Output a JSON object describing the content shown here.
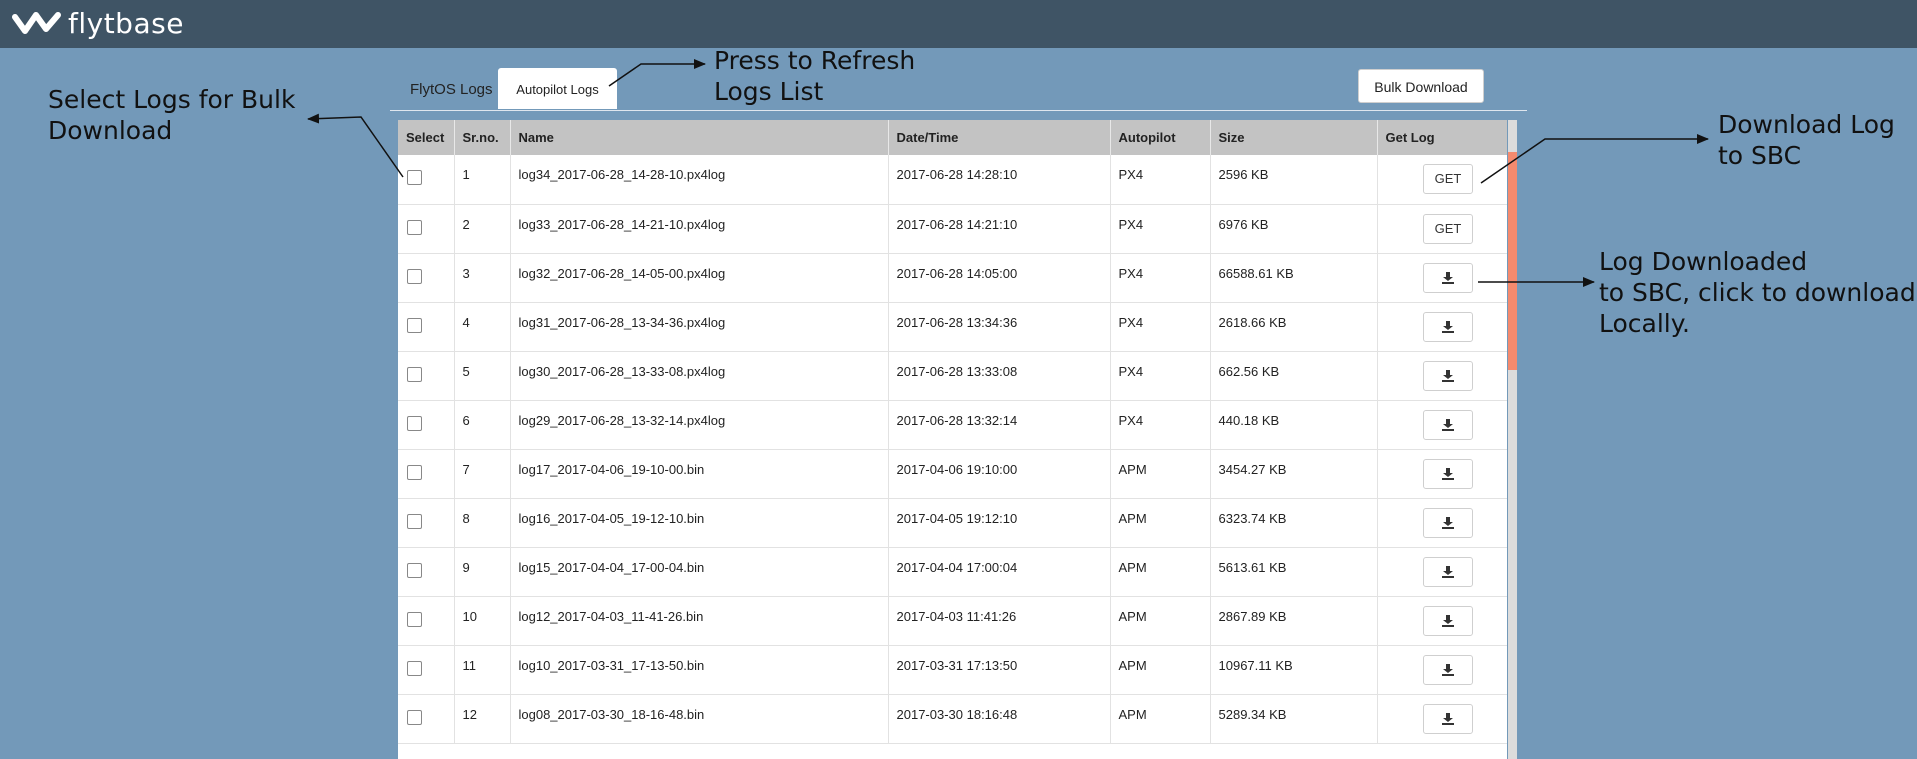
{
  "app": {
    "brand": "flytbase"
  },
  "tabs": [
    {
      "label": "FlytOS Logs",
      "active": false
    },
    {
      "label": "Autopilot Logs",
      "active": true
    }
  ],
  "toolbar": {
    "bulk_download_label": "Bulk Download"
  },
  "table": {
    "headers": [
      "Select",
      "Sr.no.",
      "Name",
      "Date/Time",
      "Autopilot",
      "Size",
      "Get Log"
    ],
    "rows": [
      {
        "sr": "1",
        "name": "log34_2017-06-28_14-28-10.px4log",
        "datetime": "2017-06-28 14:28:10",
        "autopilot": "PX4",
        "size": "2596 KB",
        "action": "get",
        "action_label": "GET"
      },
      {
        "sr": "2",
        "name": "log33_2017-06-28_14-21-10.px4log",
        "datetime": "2017-06-28 14:21:10",
        "autopilot": "PX4",
        "size": "6976 KB",
        "action": "get",
        "action_label": "GET"
      },
      {
        "sr": "3",
        "name": "log32_2017-06-28_14-05-00.px4log",
        "datetime": "2017-06-28 14:05:00",
        "autopilot": "PX4",
        "size": "66588.61 KB",
        "action": "download",
        "action_label": ""
      },
      {
        "sr": "4",
        "name": "log31_2017-06-28_13-34-36.px4log",
        "datetime": "2017-06-28 13:34:36",
        "autopilot": "PX4",
        "size": "2618.66 KB",
        "action": "download",
        "action_label": ""
      },
      {
        "sr": "5",
        "name": "log30_2017-06-28_13-33-08.px4log",
        "datetime": "2017-06-28 13:33:08",
        "autopilot": "PX4",
        "size": "662.56 KB",
        "action": "download",
        "action_label": ""
      },
      {
        "sr": "6",
        "name": "log29_2017-06-28_13-32-14.px4log",
        "datetime": "2017-06-28 13:32:14",
        "autopilot": "PX4",
        "size": "440.18 KB",
        "action": "download",
        "action_label": ""
      },
      {
        "sr": "7",
        "name": "log17_2017-04-06_19-10-00.bin",
        "datetime": "2017-04-06 19:10:00",
        "autopilot": "APM",
        "size": "3454.27 KB",
        "action": "download",
        "action_label": ""
      },
      {
        "sr": "8",
        "name": "log16_2017-04-05_19-12-10.bin",
        "datetime": "2017-04-05 19:12:10",
        "autopilot": "APM",
        "size": "6323.74 KB",
        "action": "download",
        "action_label": ""
      },
      {
        "sr": "9",
        "name": "log15_2017-04-04_17-00-04.bin",
        "datetime": "2017-04-04 17:00:04",
        "autopilot": "APM",
        "size": "5613.61 KB",
        "action": "download",
        "action_label": ""
      },
      {
        "sr": "10",
        "name": "log12_2017-04-03_11-41-26.bin",
        "datetime": "2017-04-03 11:41:26",
        "autopilot": "APM",
        "size": "2867.89 KB",
        "action": "download",
        "action_label": ""
      },
      {
        "sr": "11",
        "name": "log10_2017-03-31_17-13-50.bin",
        "datetime": "2017-03-31 17:13:50",
        "autopilot": "APM",
        "size": "10967.11 KB",
        "action": "download",
        "action_label": ""
      },
      {
        "sr": "12",
        "name": "log08_2017-03-30_18-16-48.bin",
        "datetime": "2017-03-30 18:16:48",
        "autopilot": "APM",
        "size": "5289.34 KB",
        "action": "download",
        "action_label": ""
      }
    ]
  },
  "annotations": {
    "select_logs": "Select Logs for Bulk\nDownload",
    "refresh": "Press to Refresh\nLogs List",
    "download_to_sbc": "Download Log\nto SBC",
    "downloaded_locally": "Log Downloaded\nto SBC, click to download\nLocally."
  },
  "colors": {
    "page_background": "#7399b9",
    "topbar": "#3f5465",
    "table_header": "#c3c3c3",
    "scroll_thumb": "#f48a6e"
  }
}
